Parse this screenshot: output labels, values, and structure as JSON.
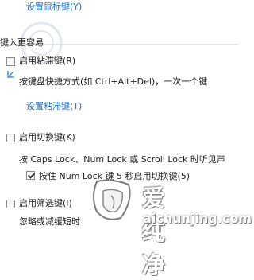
{
  "top_link": "设置鼠标键(Y)",
  "section": {
    "title": "键入更容易"
  },
  "sticky_keys": {
    "label": "启用粘滞键(R)",
    "checked": false,
    "description": "按键盘快捷方式(如 Ctrl+Alt+Del)，一次一个键",
    "settings_link": "设置粘滞键(T)"
  },
  "toggle_keys": {
    "label": "启用切换键(K)",
    "checked": false,
    "description": "按 Caps Lock、Num Lock 或 Scroll Lock 时听见声",
    "sub_option": {
      "label": "按住 Num Lock 键 5 秒启用切换键(5)",
      "checked": true
    }
  },
  "filter_keys": {
    "label": "启用筛选键(I)",
    "checked": false,
    "description": "忽略或减缓短时"
  },
  "watermark": {
    "cn": "爱纯净",
    "en": "aichunjing.com"
  },
  "colors": {
    "link": "#1a6fd0",
    "text": "#1e1e1e",
    "divider": "#e3e3e3"
  }
}
